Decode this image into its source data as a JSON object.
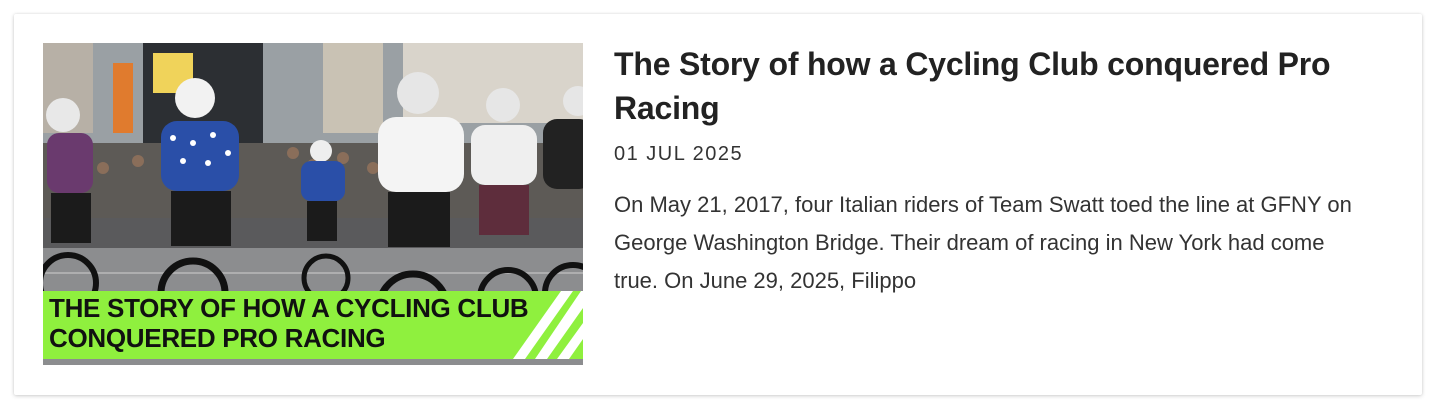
{
  "article": {
    "title": "The Story of how a Cycling Club conquered Pro Racing",
    "date": "01 JUL 2025",
    "excerpt": "On May 21, 2017, four Italian riders of Team Swatt toed the line at GFNY on George Washington Bridge. Their dream of racing in New York had come true. On June 29, 2025, Filippo",
    "thumbnail": {
      "banner_text": "THE STORY OF HOW A CYCLING CLUB\nCONQUERED PRO RACING",
      "banner_color": "#8ff03e"
    }
  }
}
